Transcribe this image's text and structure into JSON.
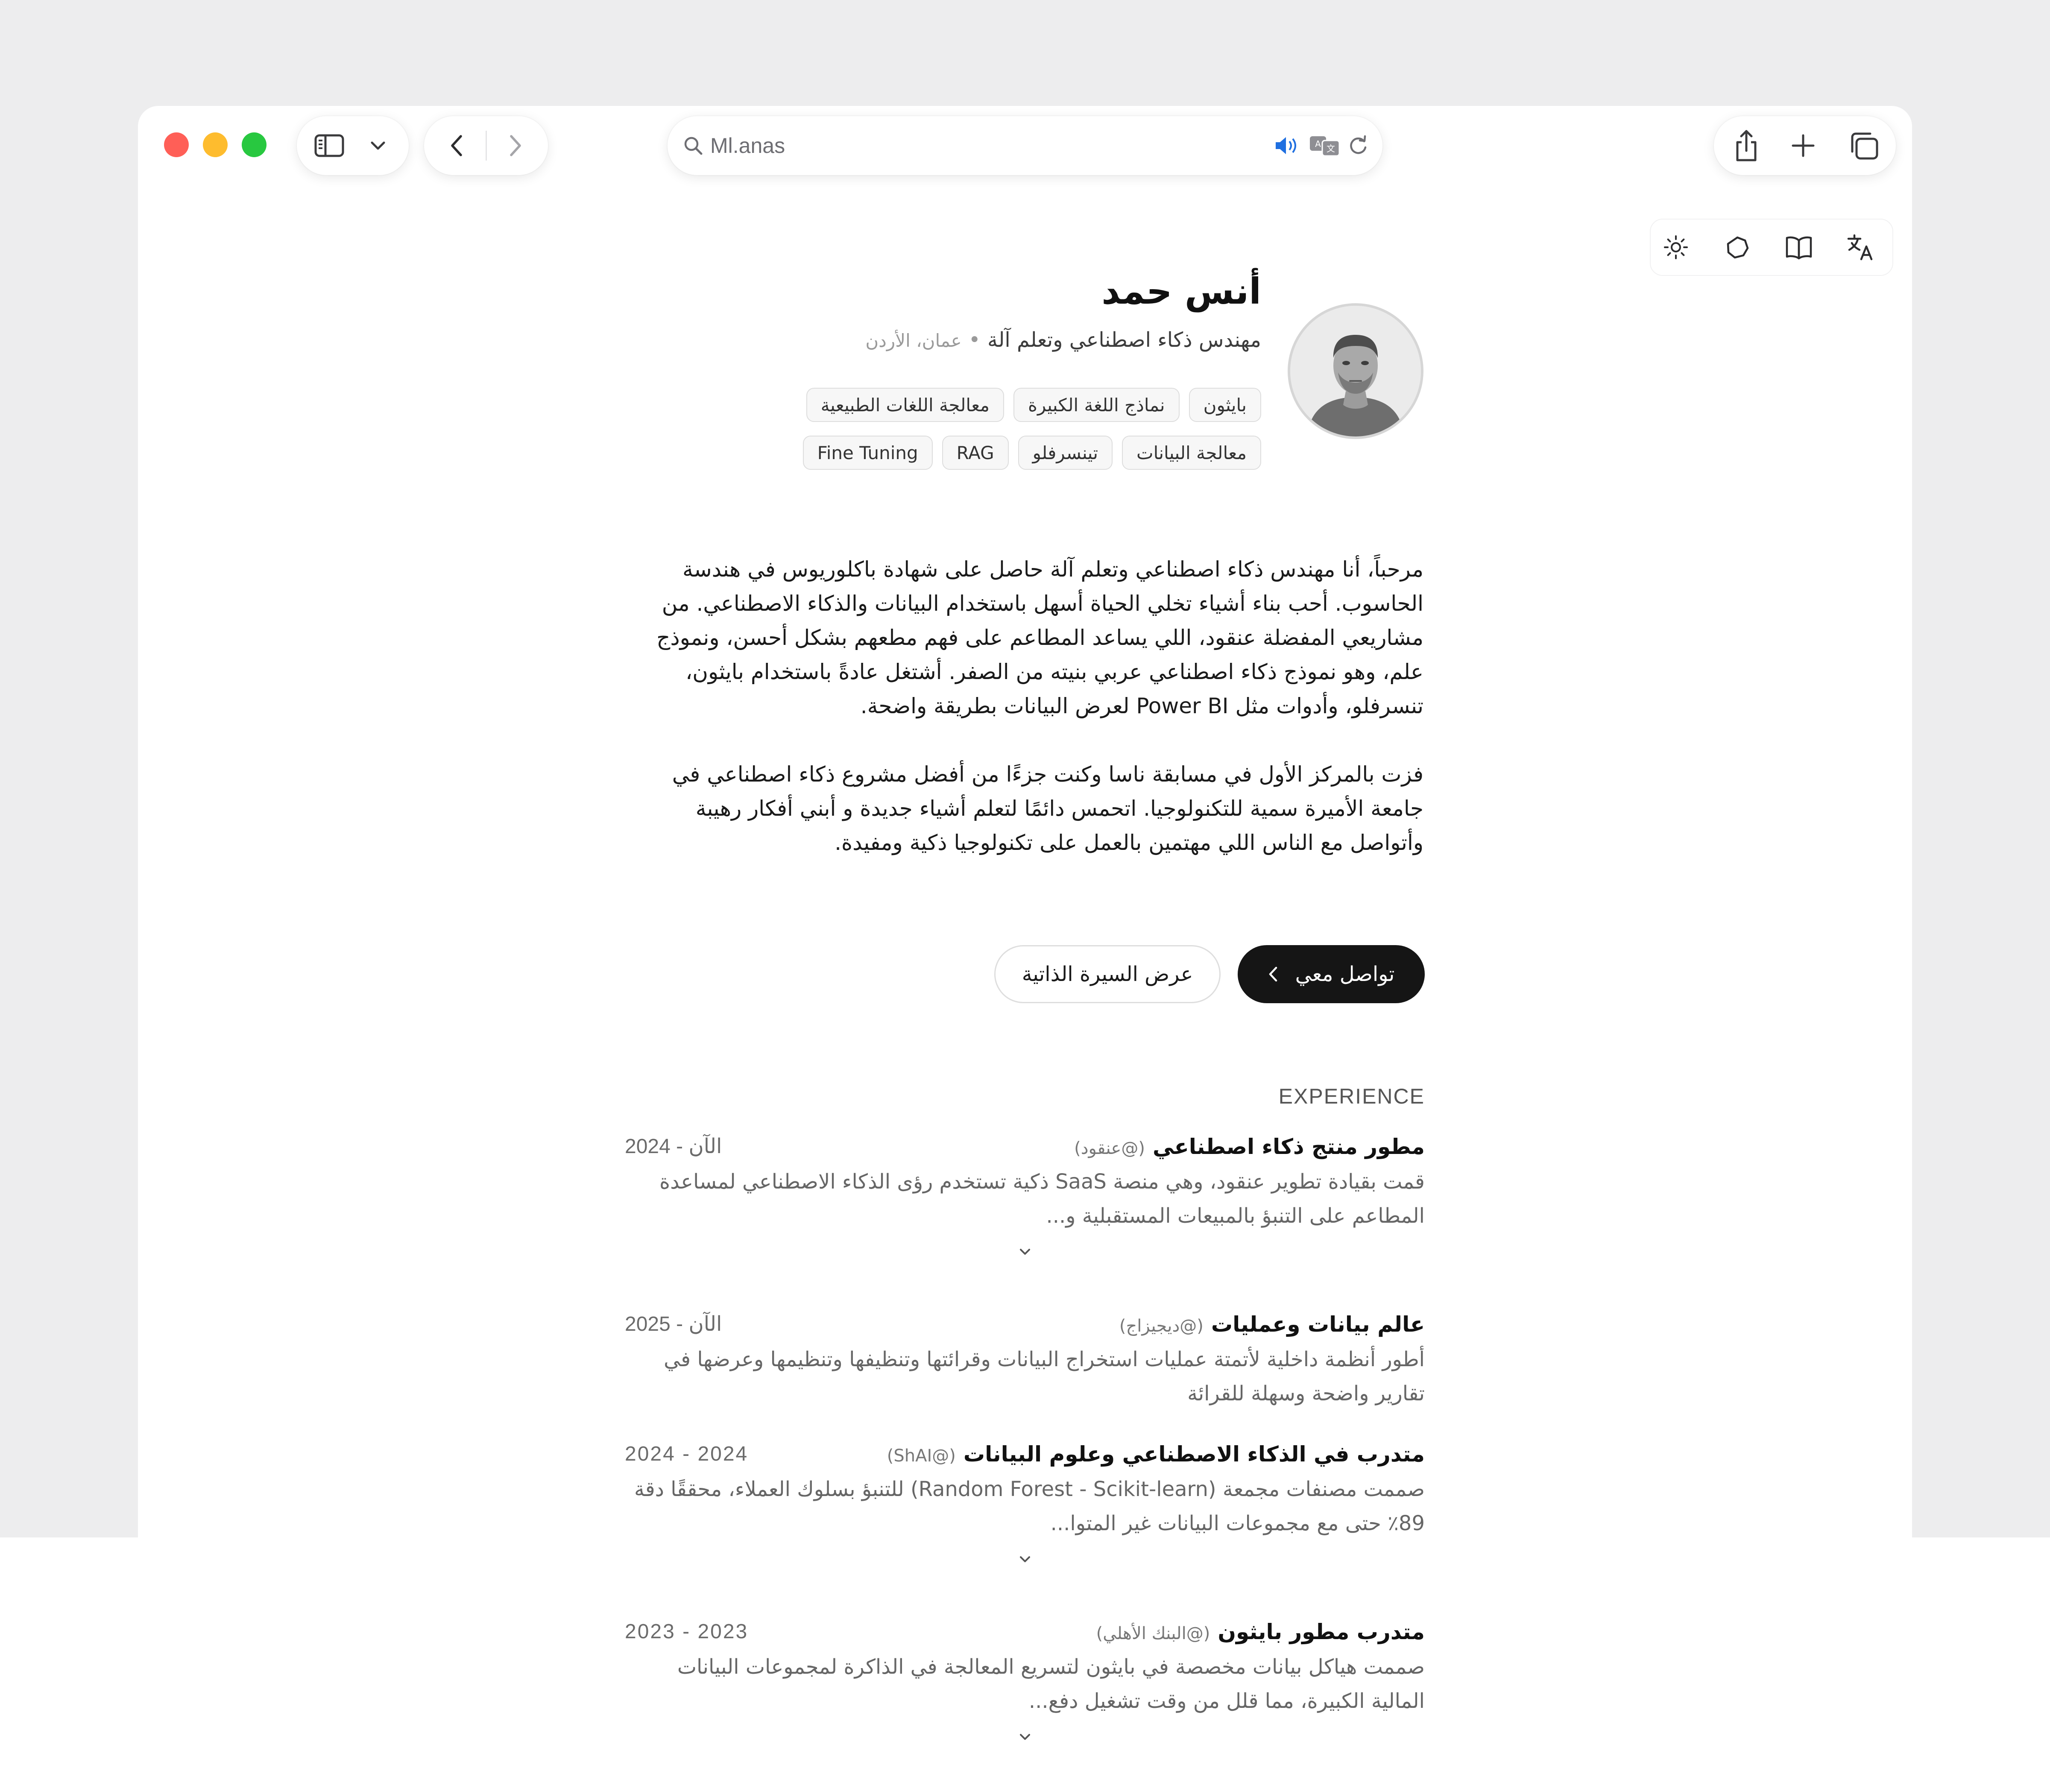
{
  "browser": {
    "address": "Ml.anas",
    "traffic_colors": {
      "close": "#ff5f57",
      "minimize": "#febc2e",
      "zoom": "#28c840"
    },
    "icons": [
      "sidebar-icon",
      "chevron-down-icon",
      "back-icon",
      "forward-icon",
      "search-icon",
      "speaker-icon",
      "translate-icon",
      "reload-icon",
      "share-icon",
      "new-tab-icon",
      "tabs-icon"
    ]
  },
  "page_toolbar": {
    "icons": [
      "sun-icon",
      "circle-icon",
      "book-icon",
      "translate-icon"
    ]
  },
  "profile": {
    "name": "أنس حمد",
    "role": "مهندس ذكاء اصطناعي وتعلم آلة",
    "separator": "•",
    "location": "عمان، الأردن",
    "tags_row1": [
      "بايثون",
      "نماذج اللغة الكبيرة",
      "معالجة اللغات الطبيعية"
    ],
    "tags_row2": [
      "معالجة البيانات",
      "تينسرفلو",
      "RAG",
      "Fine Tuning"
    ]
  },
  "bio": {
    "p1": "مرحباً، أنا مهندس ذكاء اصطناعي وتعلم آلة حاصل على شهادة باكلوريوس في هندسة الحاسوب. أحب بناء أشياء تخلي الحياة أسهل باستخدام البيانات والذكاء الاصطناعي. من مشاريعي المفضلة عنقود، اللي يساعد المطاعم على فهم مطعهم بشكل أحسن، ونموذج علم، وهو نموذج ذكاء اصطناعي عربي بنيته من الصفر. أشتغل عادةً باستخدام بايثون، تنسرفلو، وأدوات مثل Power BI لعرض البيانات بطريقة واضحة.",
    "p2": "فزت بالمركز الأول في مسابقة ناسا وكنت جزءًا من أفضل مشروع ذكاء اصطناعي في جامعة الأميرة سمية للتكنولوجيا. اتحمس دائمًا لتعلم أشياء جديدة و أبني أفكار رهيبة وأتواصل مع الناس اللي مهتمين بالعمل على تكنولوجيا ذكية ومفيدة."
  },
  "actions": {
    "contact": "تواصل معي",
    "resume": "عرض السيرة الذاتية"
  },
  "experience": {
    "title": "EXPERIENCE",
    "items": [
      {
        "title": "مطور منتج ذكاء اصطناعي",
        "handle": "(@عنقود)",
        "dates": "2024 - الآن",
        "desc": "قمت بقيادة تطوير عنقود، وهي منصة SaaS ذكية تستخدم رؤى الذكاء الاصطناعي لمساعدة المطاعم على التنبؤ بالمبيعات المستقبلية و...",
        "expandable": true
      },
      {
        "title": "عالم بيانات وعمليات",
        "handle": "(@ديجيزاج)",
        "dates": "2025 - الآن",
        "desc": "أطور أنظمة داخلية لأتمتة عمليات استخراج البيانات وقرائتها وتنظيفها وتنظيمها وعرضها في تقارير واضحة وسهلة للقرائة",
        "expandable": false
      },
      {
        "title": "متدرب في الذكاء الاصطناعي وعلوم البيانات",
        "handle": "(@ShAI)",
        "dates": "2024 - 2024",
        "desc": "صممت مصنفات مجمعة (Random Forest - Scikit-learn) للتنبؤ بسلوك العملاء، محققًا دقة 89٪ حتى مع مجموعات البيانات غير المتوا...",
        "expandable": true
      },
      {
        "title": "متدرب مطور بايثون",
        "handle": "(@البنك الأهلي)",
        "dates": "2023 - 2023",
        "desc": "صممت هياكل بيانات مخصصة في بايثون لتسريع المعالجة في الذاكرة لمجموعات البيانات المالية الكبيرة، مما قلل من وقت تشغيل دفع...",
        "expandable": true
      }
    ]
  }
}
